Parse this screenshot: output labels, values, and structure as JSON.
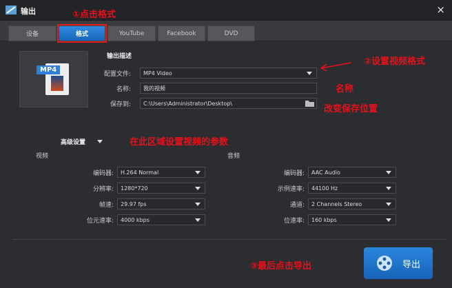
{
  "window": {
    "title": "输出",
    "close": "×"
  },
  "tabs": [
    {
      "label": "设备"
    },
    {
      "label": "格式"
    },
    {
      "label": "YouTube"
    },
    {
      "label": "Facebook"
    },
    {
      "label": "DVD"
    }
  ],
  "annotations": {
    "step1": "①点击格式",
    "step2": "②设置视频格式",
    "name": "名称",
    "save": "改变保存位置",
    "params": "在此区域设置视频的参数",
    "step3": "③最后点击导出"
  },
  "output": {
    "heading": "输出描述",
    "icon_label": "MP4",
    "profile_label": "配置文件:",
    "profile_value": "MP4 Video",
    "name_label": "名称:",
    "name_value": "我的视频",
    "save_label": "保存到:",
    "save_value": "C:\\Users\\Administrator\\Desktop\\"
  },
  "advanced": {
    "label": "高级设置",
    "video": {
      "heading": "视频",
      "rows": [
        {
          "label": "编码器:",
          "value": "H.264 Normal"
        },
        {
          "label": "分辨率:",
          "value": "1280*720"
        },
        {
          "label": "帧速:",
          "value": "29.97 fps"
        },
        {
          "label": "位元速率:",
          "value": "4000 kbps"
        }
      ]
    },
    "audio": {
      "heading": "音频",
      "rows": [
        {
          "label": "编码器:",
          "value": "AAC Audio"
        },
        {
          "label": "示例速率:",
          "value": "44100 Hz"
        },
        {
          "label": "通道:",
          "value": "2 Channels Stereo"
        },
        {
          "label": "位速率:",
          "value": "160 kbps"
        }
      ]
    }
  },
  "export_label": "导出"
}
